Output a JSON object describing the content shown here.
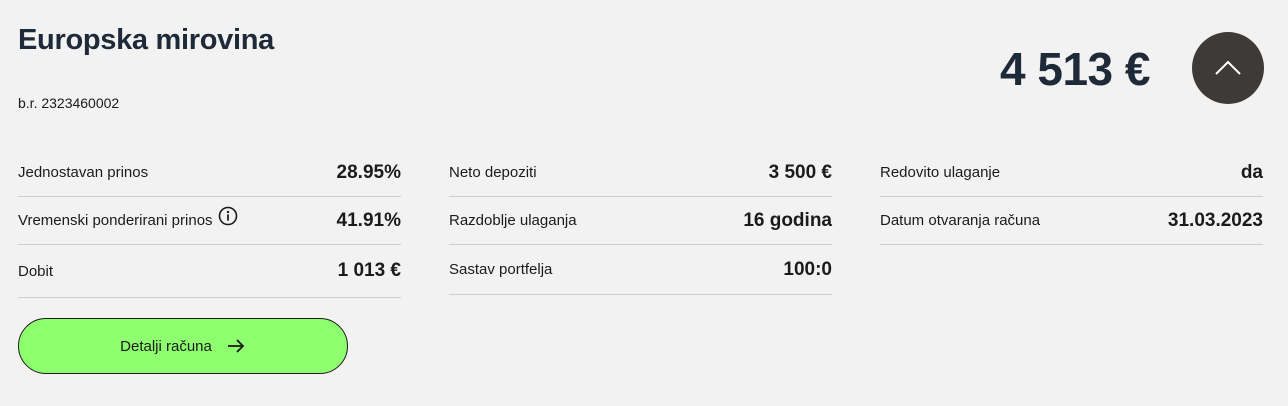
{
  "account": {
    "title": "Europska mirovina",
    "number": "b.r. 2323460002",
    "balance": "4 513 €"
  },
  "stats": {
    "col1": [
      {
        "label": "Jednostavan prinos",
        "value": "28.95%"
      },
      {
        "label": "Vremenski ponderirani prinos",
        "value": "41.91%"
      },
      {
        "label": "Dobit",
        "value": "1 013 €"
      }
    ],
    "col2": [
      {
        "label": "Neto depoziti",
        "value": "3 500 €"
      },
      {
        "label": "Razdoblje ulaganja",
        "value": "16 godina"
      },
      {
        "label": "Sastav portfelja",
        "value": "100:0"
      }
    ],
    "col3": [
      {
        "label": "Redovito ulaganje",
        "value": "da"
      },
      {
        "label": "Datum otvaranja računa",
        "value": "31.03.2023"
      }
    ]
  },
  "buttons": {
    "details_label": "Detalji računa"
  },
  "icons": {
    "collapse": "chevron-up-icon",
    "info": "info-icon",
    "arrow": "arrow-right-icon"
  },
  "colors": {
    "background": "#f2f2f2",
    "title": "#1e2a38",
    "collapse_button": "#3d3a38",
    "details_button": "#8eff6e"
  }
}
